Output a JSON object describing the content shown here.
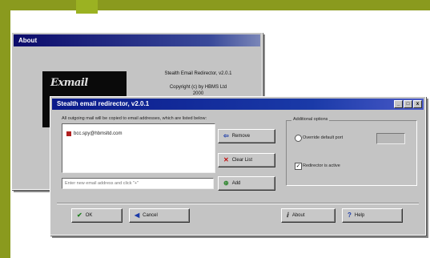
{
  "about_window": {
    "title": "About",
    "logo_text": "Exmail",
    "product": "Stealth Email Redirector, v2.0.1",
    "copyright": "Copyright (c) by HBMS Ltd",
    "year": "2000"
  },
  "main_window": {
    "title": "Stealth email redirector, v2.0.1",
    "title_buttons": [
      "_",
      "□",
      "x"
    ],
    "instructions": "All outgoing mail will be copied to email addresses, which are listed below:",
    "addresses": [
      "bcc.spy@hbmsltd.com"
    ],
    "add_placeholder": "Enter new email address and click \"+\"",
    "buttons": {
      "remove": "Remove",
      "clear": "Clear List",
      "add": "Add",
      "ok": "OK",
      "cancel": "Cancel",
      "about": "About",
      "help": "Help"
    },
    "options": {
      "title": "Additional options",
      "override_label": "Override default port",
      "port_value": "",
      "active_label": "Redirector is active"
    }
  }
}
